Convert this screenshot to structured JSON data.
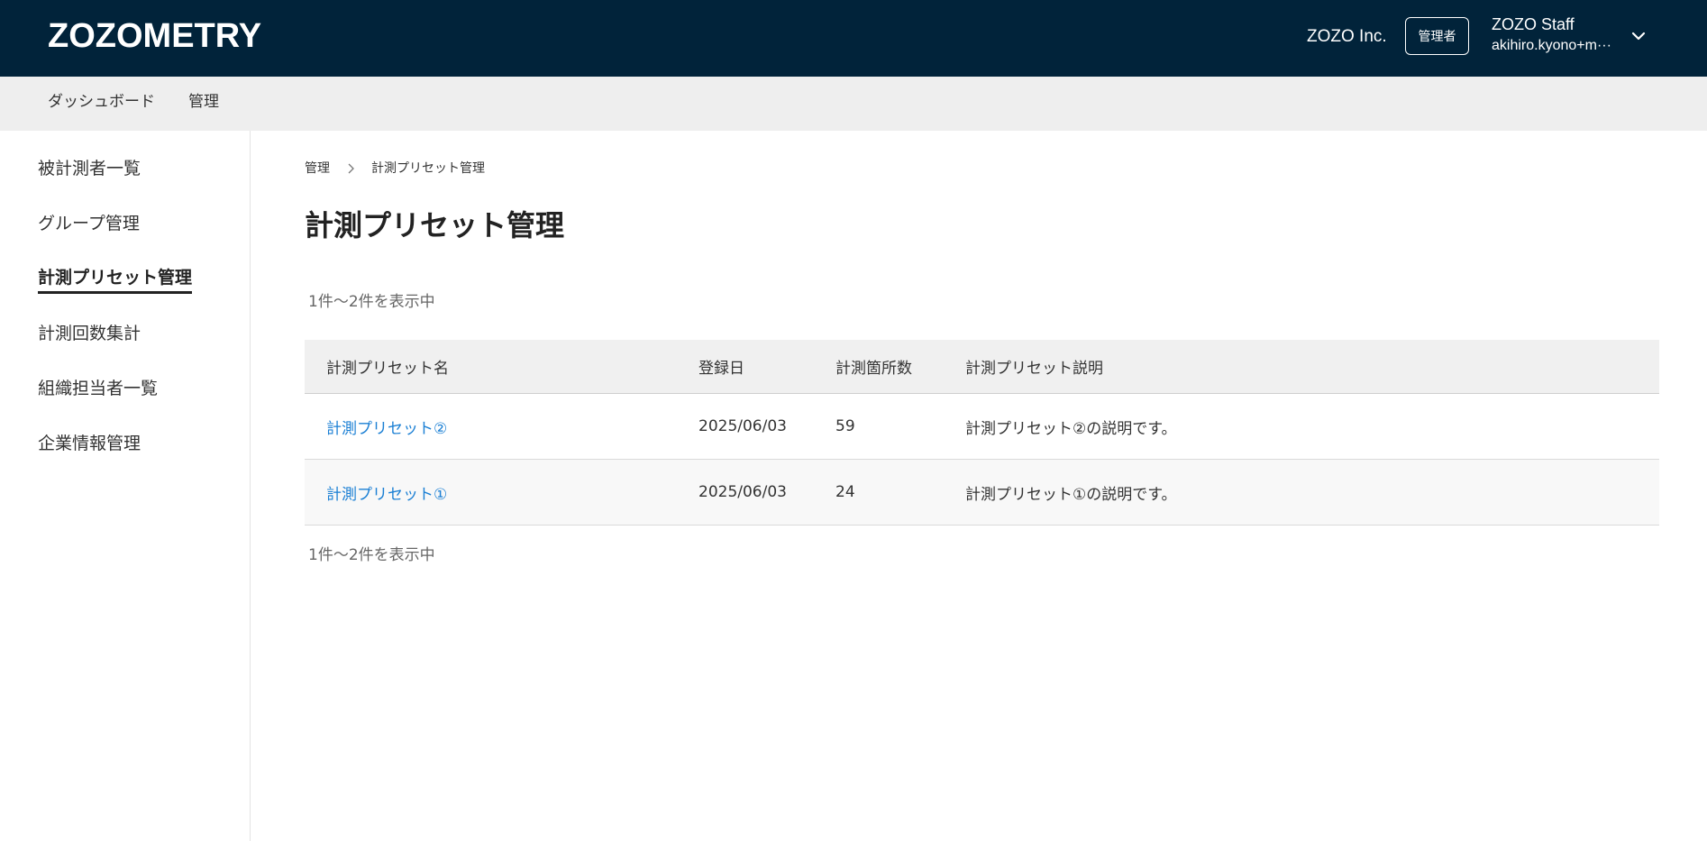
{
  "header": {
    "logo": "ZOZOMETRY",
    "company": "ZOZO Inc.",
    "role_badge": "管理者",
    "user_name": "ZOZO Staff",
    "user_email": "akihiro.kyono+m···"
  },
  "topnav": {
    "items": [
      {
        "label": "ダッシュボード"
      },
      {
        "label": "管理"
      }
    ]
  },
  "sidebar": {
    "items": [
      {
        "label": "被計測者一覧",
        "active": false
      },
      {
        "label": "グループ管理",
        "active": false
      },
      {
        "label": "計測プリセット管理",
        "active": true
      },
      {
        "label": "計測回数集計",
        "active": false
      },
      {
        "label": "組織担当者一覧",
        "active": false
      },
      {
        "label": "企業情報管理",
        "active": false
      }
    ]
  },
  "breadcrumb": {
    "items": [
      "管理",
      "計測プリセット管理"
    ]
  },
  "page": {
    "title": "計測プリセット管理",
    "count_top": "1件～2件を表示中",
    "count_bottom": "1件～2件を表示中"
  },
  "table": {
    "columns": [
      "計測プリセット名",
      "登録日",
      "計測箇所数",
      "計測プリセット説明"
    ],
    "rows": [
      {
        "name": "計測プリセット②",
        "date": "2025/06/03",
        "points": "59",
        "description": "計測プリセット②の説明です。"
      },
      {
        "name": "計測プリセット①",
        "date": "2025/06/03",
        "points": "24",
        "description": "計測プリセット①の説明です。"
      }
    ]
  },
  "colors": {
    "header_bg": "#01233a",
    "link": "#1a7fd4",
    "nav_bg": "#eeeeee"
  }
}
